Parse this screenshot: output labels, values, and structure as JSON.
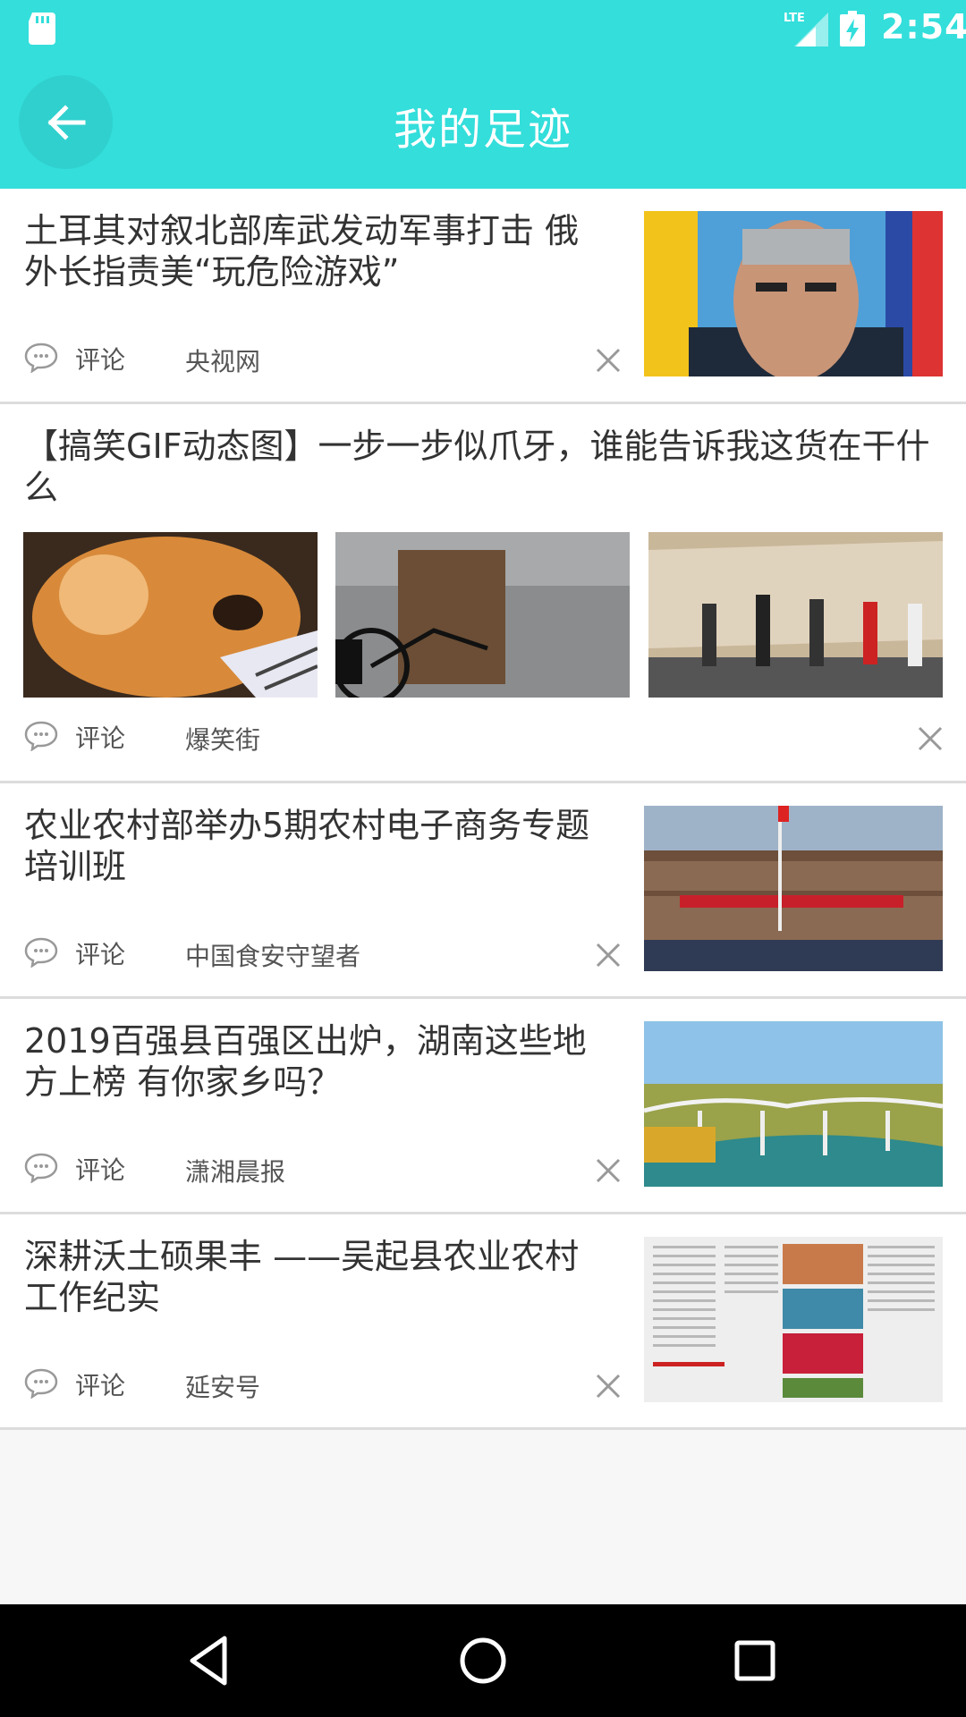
{
  "status_bar": {
    "time": "2:54",
    "network": "LTE",
    "icons": [
      "sd-card-icon",
      "lte-signal-icon",
      "battery-charging-icon"
    ]
  },
  "app_bar": {
    "title": "我的足迹",
    "back_icon": "arrow-left-icon"
  },
  "colors": {
    "accent": "#33dedb",
    "text_primary": "#333333",
    "text_secondary": "#555555",
    "divider": "#dcdcdc",
    "background": "#f7f7f7"
  },
  "items": [
    {
      "title": "土耳其对叙北部库武发动军事打击 俄外长指责美“玩危险游戏”",
      "comment_label": "评论",
      "source": "央视网",
      "thumbnails": [
        "news-photo-speaker"
      ]
    },
    {
      "title": "【搞笑GIF动态图】一步一步似爪牙，谁能告诉我这货在干什么",
      "comment_label": "评论",
      "source": "爆笑街",
      "thumbnails": [
        "cat-photo",
        "bicycle-photo",
        "treadmill-dance-photo"
      ]
    },
    {
      "title": "农业农村部举办5期农村电子商务专题培训班",
      "comment_label": "评论",
      "source": "中国食安守望者",
      "thumbnails": [
        "school-building-photo"
      ]
    },
    {
      "title": "2019百强县百强区出炉，湖南这些地方上榜 有你家乡吗？",
      "comment_label": "评论",
      "source": "潇湘晨报",
      "thumbnails": [
        "river-bridge-photo"
      ]
    },
    {
      "title": "深耕沃土硕果丰 ——吴起县农业农村工作纪实",
      "comment_label": "评论",
      "source": "延安号",
      "thumbnails": [
        "newspaper-page-photo"
      ]
    }
  ],
  "nav_bar": {
    "back_icon": "nav-back-triangle-icon",
    "home_icon": "nav-home-circle-icon",
    "recents_icon": "nav-recents-square-icon"
  }
}
